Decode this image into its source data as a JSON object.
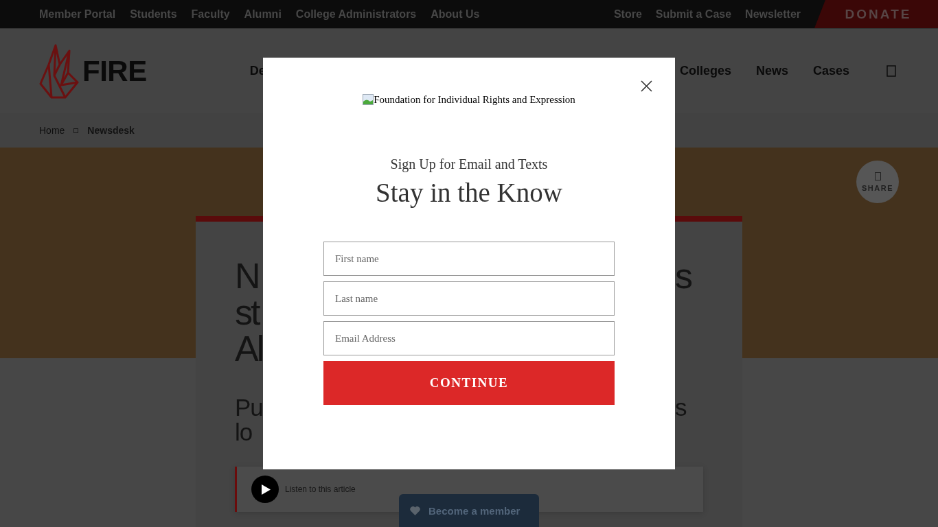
{
  "top_bar": {
    "left_links": [
      "Member Portal",
      "Students",
      "Faculty",
      "Alumni",
      "College Administrators",
      "About Us"
    ],
    "right_links": [
      "Store",
      "Submit a Case",
      "Newsletter"
    ],
    "donate_button": "DONATE"
  },
  "header": {
    "logo_text": "FIRE",
    "nav_left": [
      "De"
    ],
    "nav_right": [
      "Colleges",
      "News",
      "Cases"
    ]
  },
  "breadcrumb": [
    {
      "label": "Home",
      "current": false
    },
    {
      "label": "Newsdesk",
      "current": true
    }
  ],
  "share_button": {
    "label": "SHARE"
  },
  "article": {
    "headline_lines": [
      {
        "left": "N",
        "right": "s"
      },
      {
        "left": "st"
      },
      {
        "left": "Al"
      }
    ],
    "subtitle_lines": [
      {
        "left": "Pu",
        "right": "s"
      },
      {
        "left": "lo"
      }
    ],
    "audio_player": {
      "label": "Listen to this article"
    }
  },
  "member_button": {
    "label": "Become a member"
  },
  "modal": {
    "logo_alt": "Foundation for Individual Rights and Expression",
    "kicker": "Sign Up for Email and Texts",
    "title": "Stay in the Know",
    "fields": [
      {
        "placeholder": "First name"
      },
      {
        "placeholder": "Last name"
      },
      {
        "placeholder": "Email Address"
      }
    ],
    "submit_button": "CONTINUE"
  }
}
